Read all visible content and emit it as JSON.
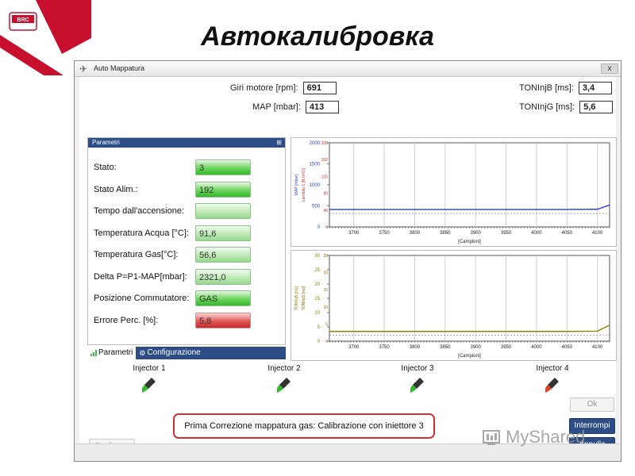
{
  "slide": {
    "title": "Автокалибровка",
    "logo_text": "BRC"
  },
  "window": {
    "title": "Auto Mappatura",
    "close_glyph": "x"
  },
  "readouts": {
    "rpm_label": "Giri motore [rpm]:",
    "rpm_value": "691",
    "map_label": "MAP [mbar]:",
    "map_value": "413",
    "tonb_label": "TONInjB [ms]:",
    "tonb_value": "3,4",
    "tong_label": "TONInjG [ms]:",
    "tong_value": "5,6"
  },
  "params": {
    "header": "Parametri",
    "rows": [
      {
        "label": "Stato:",
        "value": "3",
        "status": "green"
      },
      {
        "label": "Stato Alim.:",
        "value": "192",
        "status": "green"
      },
      {
        "label": "Tempo dall'accensione:",
        "value": "",
        "status": "pale"
      },
      {
        "label": "Temperatura Acqua [°C]:",
        "value": "91,6",
        "status": "pale"
      },
      {
        "label": "Temperatura Gas[°C]:",
        "value": "56,6",
        "status": "pale"
      },
      {
        "label": "Delta P=P1-MAP[mbar]:",
        "value": "2321,0",
        "status": "pale"
      },
      {
        "label": "Posizione Commutatore:",
        "value": "GAS",
        "status": "green"
      },
      {
        "label": "Errore Perc. [%]:",
        "value": "5,8",
        "status": "red"
      }
    ],
    "tab_active": "Parametri",
    "tab_inactive": "Configurazione"
  },
  "chart_data": [
    {
      "type": "line",
      "x": [
        3660,
        3700,
        3750,
        3800,
        3850,
        3900,
        3950,
        4000,
        4050,
        4100,
        4120
      ],
      "x_ticks": [
        "3700",
        "3750",
        "3800",
        "3850",
        "3900",
        "3950",
        "4000",
        "4050",
        "4100"
      ],
      "xlabel": "[Campioni]",
      "ylim": [
        0,
        2000
      ],
      "y_ticks_left": [
        "2000",
        "1500",
        "1000",
        "500",
        "0"
      ],
      "y_ticks_right": [
        "200",
        "160",
        "120",
        "80",
        "40",
        "0"
      ],
      "ylabel_left": "MAP [mbar]",
      "ylabel_right": "Lambda 1 [N (mV)]",
      "series": [
        {
          "values": [
            413,
            413,
            413,
            413,
            413,
            413,
            413,
            413,
            413,
            420,
            520
          ],
          "color": "#2a3fd0"
        }
      ],
      "grid": true
    },
    {
      "type": "line",
      "x": [
        3660,
        3700,
        3750,
        3800,
        3850,
        3900,
        3950,
        4000,
        4050,
        4100,
        4120
      ],
      "x_ticks": [
        "3700",
        "3750",
        "3800",
        "3850",
        "3900",
        "3950",
        "4000",
        "4050",
        "4100"
      ],
      "xlabel": "[Campioni]",
      "ylim": [
        0,
        30
      ],
      "y_ticks_left": [
        "30",
        "25",
        "20",
        "15",
        "10",
        "5",
        "0"
      ],
      "y_ticks_right": [
        "25",
        "20",
        "15",
        "10",
        "5",
        "0"
      ],
      "ylabel_left": "TONInjB [ms]",
      "ylabel_right": "TONInjG [ms]",
      "series": [
        {
          "values": [
            3.4,
            3.4,
            3.4,
            3.4,
            3.4,
            3.4,
            3.4,
            3.4,
            3.4,
            3.5,
            5.6
          ],
          "color": "#8a8a00"
        }
      ],
      "grid": true
    }
  ],
  "injectors": [
    {
      "label": "Injector 1",
      "color": "#2fb82f"
    },
    {
      "label": "Injector 2",
      "color": "#2fb82f"
    },
    {
      "label": "Injector 3",
      "color": "#2fb82f"
    },
    {
      "label": "Injector 4",
      "color": "#e04020"
    }
  ],
  "message": "Prima Correzione mappatura gas: Calibrazione con iniettore 3",
  "buttons": {
    "ok": "Ok",
    "interrompi": "Interrompi",
    "annulla": "Annulla",
    "conferma": "Conferma"
  },
  "watermark": "MyShared"
}
